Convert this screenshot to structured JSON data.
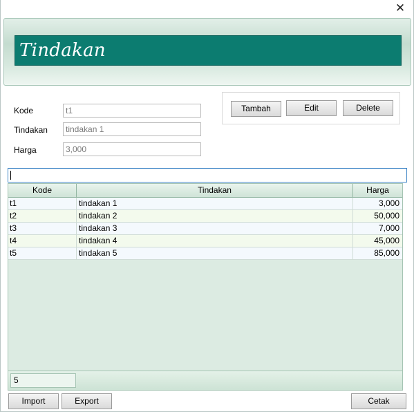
{
  "window": {
    "close_glyph": "✕"
  },
  "header": {
    "title": "Tindakan"
  },
  "form": {
    "kode": {
      "label": "Kode",
      "value": "t1"
    },
    "tindakan": {
      "label": "Tindakan",
      "value": "tindakan 1"
    },
    "harga": {
      "label": "Harga",
      "value": "3,000"
    }
  },
  "actions": {
    "tambah": "Tambah",
    "edit": "Edit",
    "delete": "Delete"
  },
  "search": {
    "value": ""
  },
  "table": {
    "columns": [
      "Kode",
      "Tindakan",
      "Harga"
    ],
    "rows": [
      {
        "kode": "t1",
        "tindakan": "tindakan 1",
        "harga": "3,000"
      },
      {
        "kode": "t2",
        "tindakan": "tindakan 2",
        "harga": "50,000"
      },
      {
        "kode": "t3",
        "tindakan": "tindakan 3",
        "harga": "7,000"
      },
      {
        "kode": "t4",
        "tindakan": "tindakan 4",
        "harga": "45,000"
      },
      {
        "kode": "t5",
        "tindakan": "tindakan 5",
        "harga": "85,000"
      }
    ],
    "row_count": "5"
  },
  "bottom": {
    "import": "Import",
    "export": "Export",
    "cetak": "Cetak"
  }
}
